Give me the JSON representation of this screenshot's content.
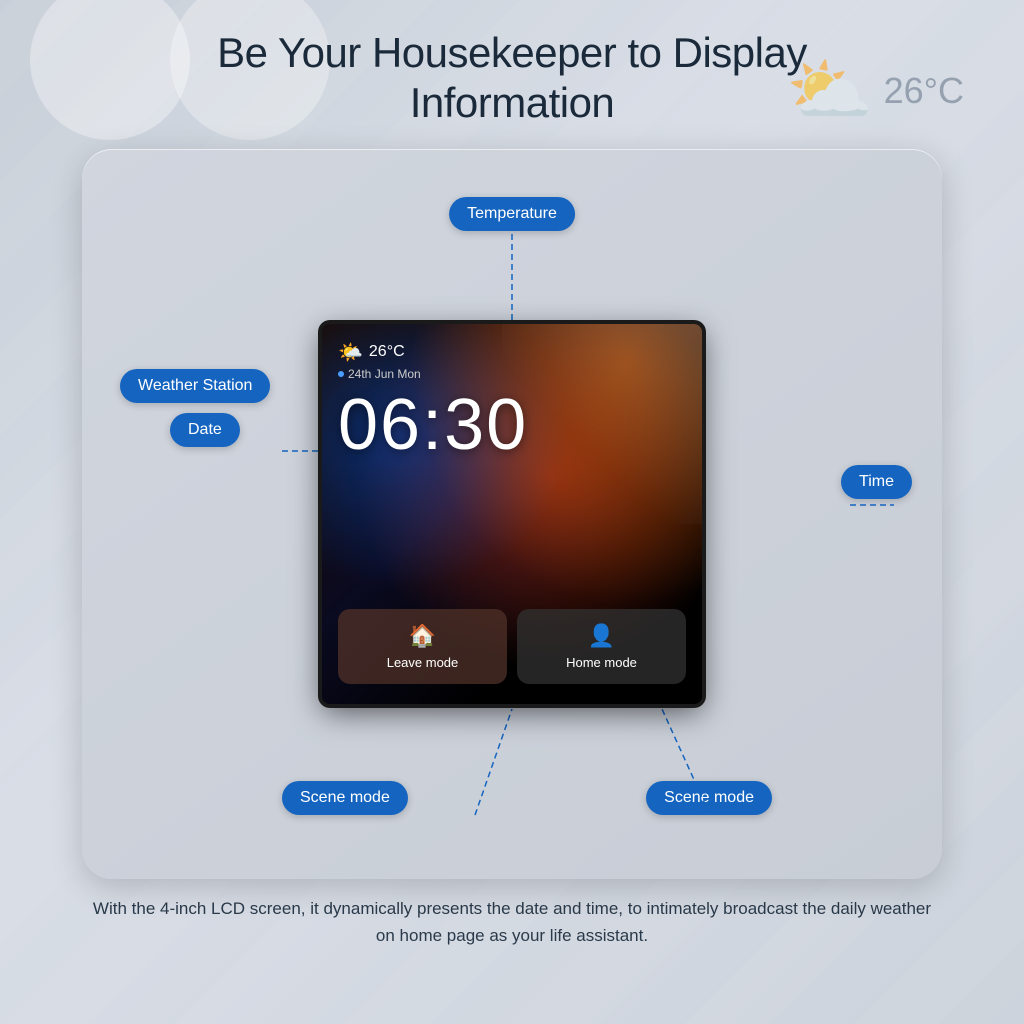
{
  "page": {
    "title_line1": "Be Your Housekeeper to Display",
    "title_line2": "Information"
  },
  "bg_weather": {
    "temp": "26°C"
  },
  "screen": {
    "weather_emoji": "🌤️",
    "temperature": "26°C",
    "date": "24th Jun Mon",
    "time": "06:30"
  },
  "mode_buttons": [
    {
      "icon": "🏠",
      "label": "Leave mode"
    },
    {
      "icon": "👤",
      "label": "Home mode"
    }
  ],
  "annotations": {
    "temperature": "Temperature",
    "weather_station": "Weather Station",
    "date": "Date",
    "time": "Time",
    "scene_mode_left": "Scene mode",
    "scene_mode_right": "Scene mode"
  },
  "footer": {
    "text": "With the 4-inch LCD screen, it dynamically presents the date and time, to intimately broadcast the daily weather on home page as your life assistant."
  }
}
